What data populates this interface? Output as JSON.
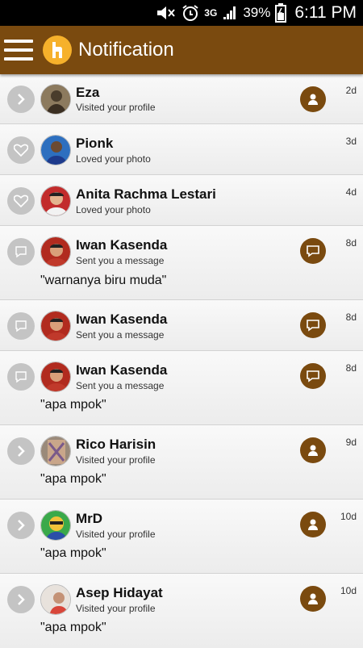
{
  "status": {
    "network": "3G",
    "battery": "39%",
    "time": "6:11 PM"
  },
  "header": {
    "title": "Notification"
  },
  "colors": {
    "brand": "#7a4a0f",
    "logo": "#f6b12b"
  },
  "notifications": [
    {
      "name": "Eza",
      "action": "Visited your profile",
      "time": "2d",
      "type": "visit",
      "message": ""
    },
    {
      "name": "Pionk",
      "action": "Loved your photo",
      "time": "3d",
      "type": "love",
      "message": ""
    },
    {
      "name": "Anita Rachma Lestari",
      "action": "Loved your photo",
      "time": "4d",
      "type": "love",
      "message": ""
    },
    {
      "name": "Iwan Kasenda",
      "action": "Sent you a message",
      "time": "8d",
      "type": "message",
      "message": "\"warnanya biru muda\""
    },
    {
      "name": "Iwan Kasenda",
      "action": "Sent you a message",
      "time": "8d",
      "type": "message",
      "message": ""
    },
    {
      "name": "Iwan Kasenda",
      "action": "Sent you a message",
      "time": "8d",
      "type": "message",
      "message": "\"apa mpok\""
    },
    {
      "name": "Rico Harisin",
      "action": "Visited your profile",
      "time": "9d",
      "type": "visit",
      "message": "\"apa mpok\""
    },
    {
      "name": "MrD",
      "action": "Visited your profile",
      "time": "10d",
      "type": "visit",
      "message": "\"apa mpok\""
    },
    {
      "name": "Asep Hidayat",
      "action": "Visited your profile",
      "time": "10d",
      "type": "visit",
      "message": "\"apa mpok\""
    }
  ]
}
